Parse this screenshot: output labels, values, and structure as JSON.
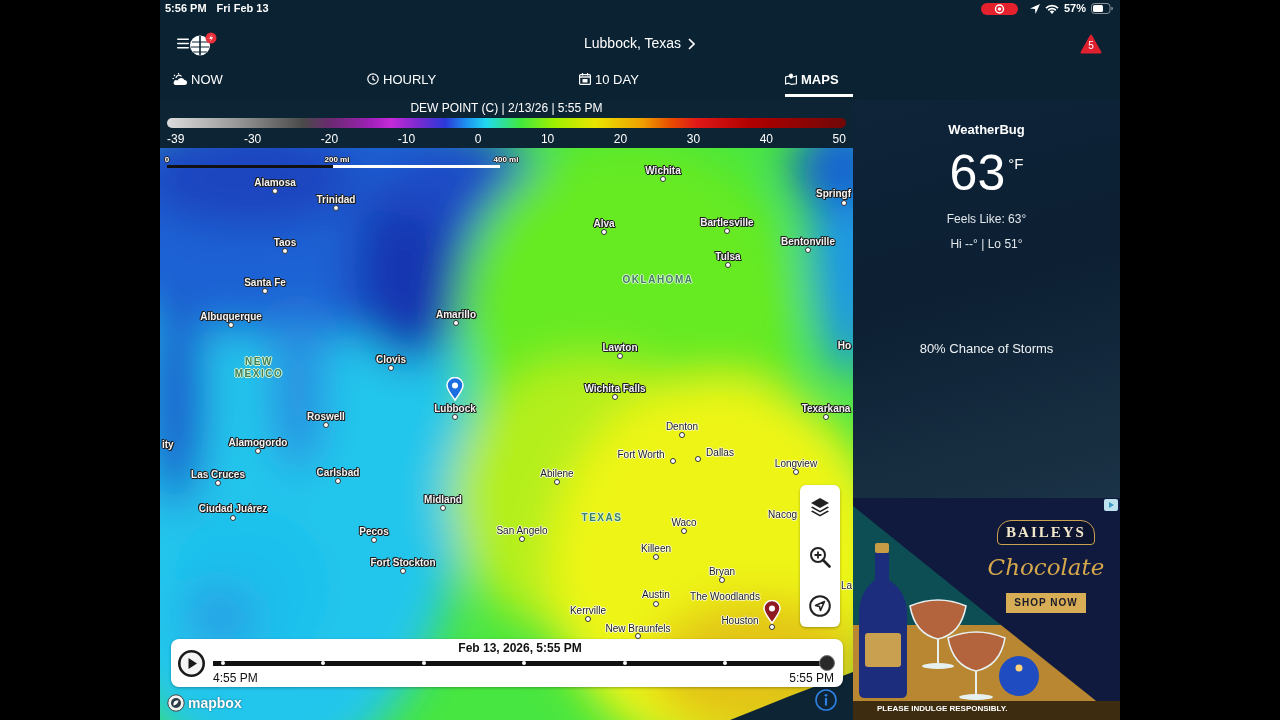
{
  "status_bar": {
    "time": "5:56 PM",
    "date": "Fri Feb 13",
    "battery": "57%"
  },
  "header": {
    "location": "Lubbock, Texas",
    "alert_count": "5"
  },
  "tabs": [
    {
      "label": "NOW",
      "selected": false
    },
    {
      "label": "HOURLY",
      "selected": false
    },
    {
      "label": "10 DAY",
      "selected": false
    },
    {
      "label": "MAPS",
      "selected": true
    }
  ],
  "legend": {
    "title": "DEW POINT (C) | 2/13/26 | 5:55 PM",
    "ticks": [
      "-39",
      "-30",
      "-20",
      "-10",
      "0",
      "10",
      "20",
      "30",
      "40",
      "50"
    ]
  },
  "map": {
    "scale": [
      "0",
      "200 mi",
      "400 mi"
    ],
    "places": [
      {
        "name": "Wichita",
        "kind": "city"
      },
      {
        "name": "Alamosa",
        "kind": "city"
      },
      {
        "name": "Springf",
        "kind": "city"
      },
      {
        "name": "Trinidad",
        "kind": "city"
      },
      {
        "name": "Alva",
        "kind": "city"
      },
      {
        "name": "Bartlesville",
        "kind": "city"
      },
      {
        "name": "Taos",
        "kind": "city"
      },
      {
        "name": "Bentonville",
        "kind": "city"
      },
      {
        "name": "Tulsa",
        "kind": "city"
      },
      {
        "name": "Santa Fe",
        "kind": "city"
      },
      {
        "name": "OKLAHOMA",
        "kind": "state"
      },
      {
        "name": "Albuquerque",
        "kind": "city"
      },
      {
        "name": "Amarillo",
        "kind": "city"
      },
      {
        "name": "Lawton",
        "kind": "city"
      },
      {
        "name": "Ho",
        "kind": "city"
      },
      {
        "name": "Clovis",
        "kind": "city"
      },
      {
        "name": "NEW MEXICO",
        "kind": "state"
      },
      {
        "name": "Wichita Falls",
        "kind": "city"
      },
      {
        "name": "Lubbock",
        "kind": "city"
      },
      {
        "name": "Roswell",
        "kind": "city"
      },
      {
        "name": "Texarkana",
        "kind": "city"
      },
      {
        "name": "Denton",
        "kind": "city"
      },
      {
        "name": "ity",
        "kind": "city"
      },
      {
        "name": "Alamogordo",
        "kind": "city"
      },
      {
        "name": "Fort Worth",
        "kind": "city"
      },
      {
        "name": "Dallas",
        "kind": "city"
      },
      {
        "name": "Longview",
        "kind": "city"
      },
      {
        "name": "Las Cruces",
        "kind": "city"
      },
      {
        "name": "Carlsbad",
        "kind": "city"
      },
      {
        "name": "Abilene",
        "kind": "city"
      },
      {
        "name": "Midland",
        "kind": "city"
      },
      {
        "name": "Ciudad Juárez",
        "kind": "city"
      },
      {
        "name": "Nacog",
        "kind": "city"
      },
      {
        "name": "TEXAS",
        "kind": "state"
      },
      {
        "name": "Waco",
        "kind": "city"
      },
      {
        "name": "San Angelo",
        "kind": "city"
      },
      {
        "name": "Pecos",
        "kind": "city"
      },
      {
        "name": "Killeen",
        "kind": "city"
      },
      {
        "name": "Fort Stockton",
        "kind": "city"
      },
      {
        "name": "Bryan",
        "kind": "city"
      },
      {
        "name": "La",
        "kind": "city"
      },
      {
        "name": "Austin",
        "kind": "city"
      },
      {
        "name": "The Woodlands",
        "kind": "city"
      },
      {
        "name": "Kerrville",
        "kind": "city"
      },
      {
        "name": "Houston",
        "kind": "city"
      },
      {
        "name": "New Braunfels",
        "kind": "city"
      }
    ],
    "pins": [
      {
        "color": "#1c6fe0"
      },
      {
        "color": "#8e1b22"
      }
    ],
    "timeline": {
      "datetime": "Feb 13, 2026, 5:55 PM",
      "start": "4:55 PM",
      "end": "5:55 PM",
      "level": 1
    },
    "attribution": "mapbox"
  },
  "current": {
    "source": "WeatherBug",
    "temperature": "63",
    "unit": "°F",
    "feels_like": "Feels Like: 63°",
    "hi_lo": "Hi --° | Lo 51°",
    "forecast": "80% Chance of Storms"
  },
  "ad": {
    "brand": "BAILEYS",
    "product": "Chocolate",
    "cta": "SHOP NOW",
    "disclaimer": "PLEASE INDULGE RESPONSIBLY."
  }
}
